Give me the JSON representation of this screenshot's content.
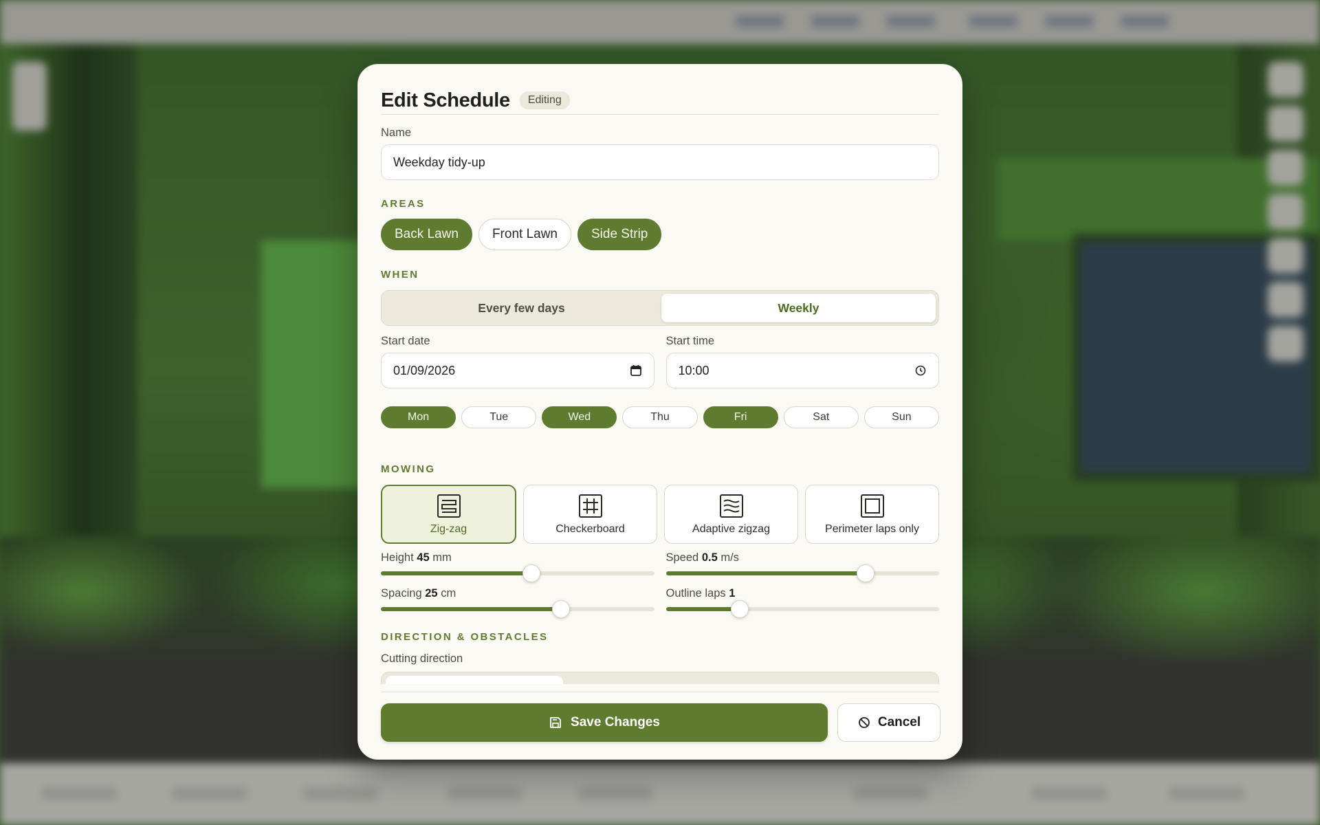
{
  "header": {
    "title": "Edit Schedule",
    "badge": "Editing"
  },
  "name_field": {
    "label": "Name",
    "value": "Weekday tidy-up"
  },
  "areas": {
    "heading": "AREAS",
    "items": [
      {
        "label": "Back Lawn",
        "selected": true
      },
      {
        "label": "Front Lawn",
        "selected": false
      },
      {
        "label": "Side Strip",
        "selected": true
      }
    ]
  },
  "when": {
    "heading": "WHEN",
    "modes": [
      {
        "label": "Every few days",
        "selected": false
      },
      {
        "label": "Weekly",
        "selected": true
      }
    ],
    "start_date": {
      "label": "Start date",
      "value": "01/09/2026"
    },
    "start_time": {
      "label": "Start time",
      "value": "10:00"
    },
    "days": [
      {
        "label": "Mon",
        "selected": true
      },
      {
        "label": "Tue",
        "selected": false
      },
      {
        "label": "Wed",
        "selected": true
      },
      {
        "label": "Thu",
        "selected": false
      },
      {
        "label": "Fri",
        "selected": true
      },
      {
        "label": "Sat",
        "selected": false
      },
      {
        "label": "Sun",
        "selected": false
      }
    ]
  },
  "mowing": {
    "heading": "MOWING",
    "patterns": [
      {
        "label": "Zig-zag",
        "icon": "zigzag-pattern-icon",
        "selected": true
      },
      {
        "label": "Checkerboard",
        "icon": "checkerboard-pattern-icon",
        "selected": false
      },
      {
        "label": "Adaptive zigzag",
        "icon": "adaptive-zigzag-pattern-icon",
        "selected": false
      },
      {
        "label": "Perimeter laps only",
        "icon": "perimeter-pattern-icon",
        "selected": false
      }
    ],
    "height": {
      "label": "Height",
      "value": "45",
      "unit": "mm",
      "fraction": 0.55
    },
    "speed": {
      "label": "Speed",
      "value": "0.5",
      "unit": "m/s",
      "fraction": 0.73
    },
    "spacing": {
      "label": "Spacing",
      "value": "25",
      "unit": "cm",
      "fraction": 0.66
    },
    "outline_laps": {
      "label": "Outline laps",
      "value": "1",
      "unit": "",
      "fraction": 0.27
    }
  },
  "direction": {
    "heading": "DIRECTION & OBSTACLES",
    "cutting_label": "Cutting direction"
  },
  "footer": {
    "save_label": "Save Changes",
    "cancel_label": "Cancel"
  },
  "colors": {
    "accent": "#5e7b30",
    "surface": "#fbf9f3",
    "selected_tint": "#eef2dd"
  }
}
